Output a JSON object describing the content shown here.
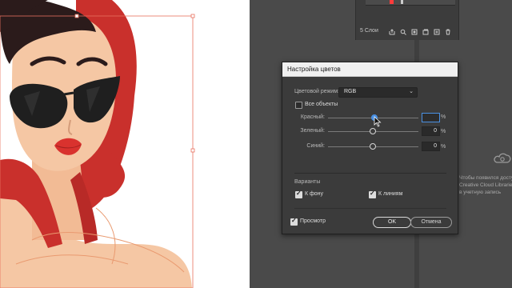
{
  "layers_panel": {
    "count_label": "5 Слои"
  },
  "dialog": {
    "title": "Настройка цветов",
    "color_mode_label": "Цветовой режим:",
    "color_mode_value": "RGB",
    "all_objects_label": "Все объекты",
    "all_objects_checked": false,
    "sliders": [
      {
        "label": "Красный:",
        "value": "",
        "percent": "%",
        "level": 0.5,
        "focused": true
      },
      {
        "label": "Зеленый:",
        "value": "0",
        "percent": "%",
        "level": 0.5,
        "focused": false
      },
      {
        "label": "Синий:",
        "value": "0",
        "percent": "%",
        "level": 0.5,
        "focused": false
      }
    ],
    "variants_label": "Варианты",
    "fill_label": "К фону",
    "fill_checked": true,
    "stroke_label": "К линиям",
    "stroke_checked": true,
    "preview_label": "Просмотр",
    "preview_checked": true,
    "ok_label": "OK",
    "cancel_label": "Отмена"
  },
  "libraries_panel": {
    "hint_lines": [
      "Чтобы появился досту",
      "Creative Cloud Libraries,",
      "в учетную запись"
    ]
  },
  "colors": {
    "accent": "#4a90e2",
    "scarf_red": "#c9302c",
    "skin": "#f5c7a4",
    "hair": "#2b1b1b"
  }
}
